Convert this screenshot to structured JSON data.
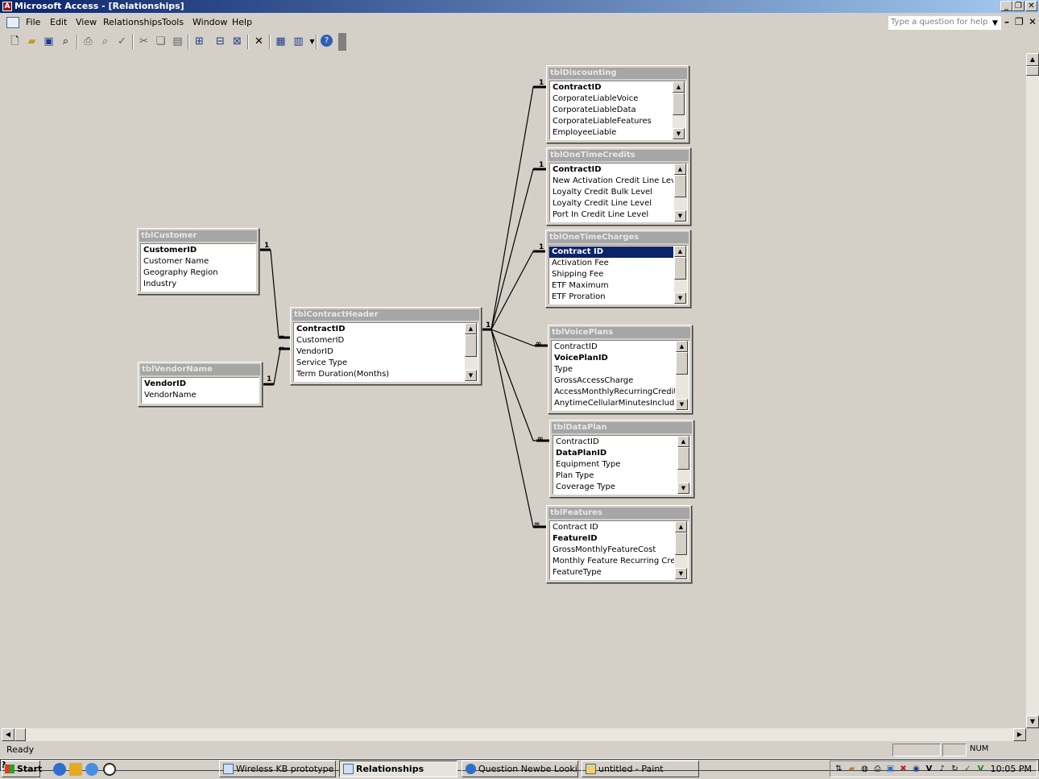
{
  "window": {
    "title": "Microsoft Access - [Relationships]",
    "buttons": {
      "minimize": "_",
      "restore": "❐",
      "close": "✕"
    }
  },
  "menu": {
    "items": [
      "File",
      "Edit",
      "View",
      "Relationships",
      "Tools",
      "Window",
      "Help"
    ],
    "help_placeholder": "Type a question for help"
  },
  "toolbar": {
    "icons": [
      "new-icon",
      "open-icon",
      "save-icon",
      "search-icon",
      "print-icon",
      "print-preview-icon",
      "spelling-icon",
      "cut-icon",
      "copy-icon",
      "paste-icon",
      "show-table-icon",
      "show-direct-icon",
      "show-all-icon",
      "delete-icon",
      "new-object-icon",
      "database-window-icon",
      "help-icon"
    ]
  },
  "tables": {
    "tblCustomer": {
      "title": "tblCustomer",
      "fields": [
        "CustomerID",
        "Customer Name",
        "Geography Region",
        "Industry"
      ]
    },
    "tblVendorName": {
      "title": "tblVendorName",
      "fields": [
        "VendorID",
        "VendorName"
      ]
    },
    "tblContractHeader": {
      "title": "tblContractHeader",
      "fields": [
        "ContractID",
        "CustomerID",
        "VendorID",
        "Service Type",
        "Term Duration(Months)"
      ]
    },
    "tblDiscounting": {
      "title": "tblDiscounting",
      "fields": [
        "ContractID",
        "CorporateLiableVoice",
        "CorporateLiableData",
        "CorporateLiableFeatures",
        "EmployeeLiable"
      ]
    },
    "tblOneTimeCredits": {
      "title": "tblOneTimeCredits",
      "fields": [
        "ContractID",
        "New Activation Credit Line Level",
        "Loyalty Credit Bulk Level",
        "Loyalty Credit Line Level",
        "Port In Credit Line Level"
      ]
    },
    "tblOneTimeCharges": {
      "title": "tblOneTimeCharges",
      "fields": [
        "Contract ID",
        "Activation Fee",
        "Shipping Fee",
        "ETF Maximum",
        "ETF Proration"
      ]
    },
    "tblVoicePlans": {
      "title": "tblVoicePlans",
      "fields": [
        "ContractID",
        "VoicePlanID",
        "Type",
        "GrossAccessCharge",
        "AccessMonthlyRecurringCredit",
        "AnytimeCellularMinutesIncluded"
      ]
    },
    "tblDataPlan": {
      "title": "tblDataPlan",
      "fields": [
        "ContractID",
        "DataPlanID",
        "Equipment Type",
        "Plan Type",
        "Coverage Type"
      ]
    },
    "tblFeatures": {
      "title": "tblFeatures",
      "fields": [
        "Contract ID",
        "FeatureID",
        "GrossMonthlyFeatureCost",
        "Monthly Feature Recurring Credit",
        "FeatureType"
      ]
    }
  },
  "relationship_labels": {
    "one": "1",
    "many": "∞"
  },
  "status": {
    "text": "Ready",
    "num": "NUM"
  },
  "taskbar": {
    "start": "Start",
    "tasks": [
      "Wireless KB prototype : ...",
      "Relationships",
      "Question Newbe Looking...",
      "untitled - Paint"
    ],
    "clock": "10:05 PM"
  },
  "colors": {
    "title_active": "#0a246a",
    "selection": "#0a246a",
    "table_header": "#a6a6a6"
  }
}
